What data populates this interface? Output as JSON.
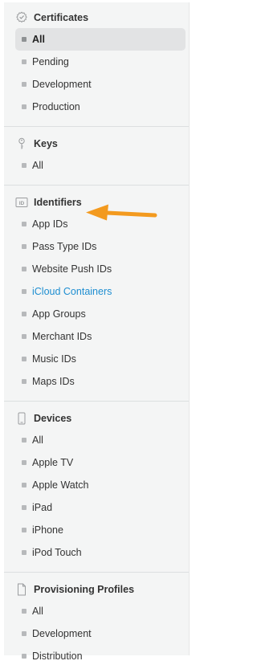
{
  "colors": {
    "panel_bg": "#f4f5f5",
    "active_item_bg": "#e2e3e4",
    "link": "#1e8ed1",
    "arrow": "#f39a1f"
  },
  "sections": [
    {
      "title": "Certificates",
      "icon": "certificate-badge-icon",
      "items": [
        "All",
        "Pending",
        "Development",
        "Production"
      ]
    },
    {
      "title": "Keys",
      "icon": "key-icon",
      "items": [
        "All"
      ]
    },
    {
      "title": "Identifiers",
      "icon": "id-icon",
      "icon_text": "ID",
      "items": [
        "App IDs",
        "Pass Type IDs",
        "Website Push IDs",
        "iCloud Containers",
        "App Groups",
        "Merchant IDs",
        "Music IDs",
        "Maps IDs"
      ]
    },
    {
      "title": "Devices",
      "icon": "device-icon",
      "items": [
        "All",
        "Apple TV",
        "Apple Watch",
        "iPad",
        "iPhone",
        "iPod Touch"
      ]
    },
    {
      "title": "Provisioning Profiles",
      "icon": "document-icon",
      "items": [
        "All",
        "Development",
        "Distribution"
      ]
    }
  ],
  "selected_item": "Certificates/All",
  "annotation": {
    "icon": "orange-arrow-icon",
    "points_to": "App IDs"
  }
}
